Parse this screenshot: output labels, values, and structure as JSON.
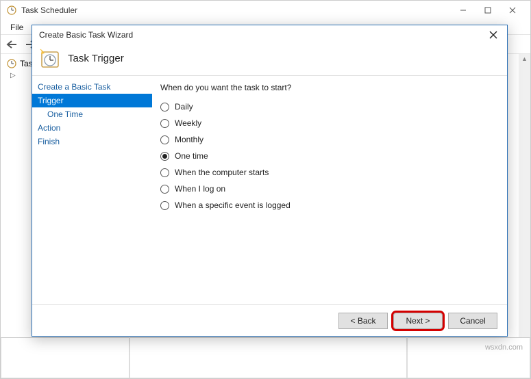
{
  "app": {
    "title": "Task Scheduler",
    "menu": {
      "file": "File"
    },
    "tree": {
      "root": "Task Scheduler (Local)",
      "root_short": "Tas"
    }
  },
  "wizard": {
    "title": "Create Basic Task Wizard",
    "header": "Task Trigger",
    "steps": {
      "create": "Create a Basic Task",
      "trigger": "Trigger",
      "one_time": "One Time",
      "action": "Action",
      "finish": "Finish"
    },
    "prompt": "When do you want the task to start?",
    "options": {
      "daily": "Daily",
      "weekly": "Weekly",
      "monthly": "Monthly",
      "one_time": "One time",
      "computer_starts": "When the computer starts",
      "log_on": "When I log on",
      "event_logged": "When a specific event is logged"
    },
    "selected_option": "one_time",
    "buttons": {
      "back": "< Back",
      "next": "Next >",
      "cancel": "Cancel"
    }
  },
  "watermark": "wsxdn.com"
}
